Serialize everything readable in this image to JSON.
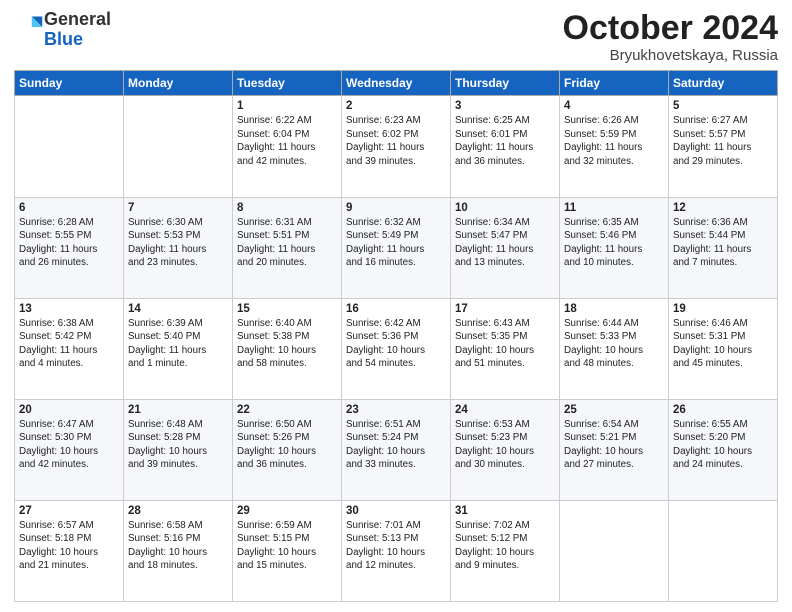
{
  "logo": {
    "general": "General",
    "blue": "Blue"
  },
  "header": {
    "month": "October 2024",
    "location": "Bryukhovetskaya, Russia"
  },
  "weekdays": [
    "Sunday",
    "Monday",
    "Tuesday",
    "Wednesday",
    "Thursday",
    "Friday",
    "Saturday"
  ],
  "weeks": [
    [
      {
        "day": "",
        "sunrise": "",
        "sunset": "",
        "daylight": ""
      },
      {
        "day": "",
        "sunrise": "",
        "sunset": "",
        "daylight": ""
      },
      {
        "day": "1",
        "sunrise": "Sunrise: 6:22 AM",
        "sunset": "Sunset: 6:04 PM",
        "daylight": "Daylight: 11 hours and 42 minutes."
      },
      {
        "day": "2",
        "sunrise": "Sunrise: 6:23 AM",
        "sunset": "Sunset: 6:02 PM",
        "daylight": "Daylight: 11 hours and 39 minutes."
      },
      {
        "day": "3",
        "sunrise": "Sunrise: 6:25 AM",
        "sunset": "Sunset: 6:01 PM",
        "daylight": "Daylight: 11 hours and 36 minutes."
      },
      {
        "day": "4",
        "sunrise": "Sunrise: 6:26 AM",
        "sunset": "Sunset: 5:59 PM",
        "daylight": "Daylight: 11 hours and 32 minutes."
      },
      {
        "day": "5",
        "sunrise": "Sunrise: 6:27 AM",
        "sunset": "Sunset: 5:57 PM",
        "daylight": "Daylight: 11 hours and 29 minutes."
      }
    ],
    [
      {
        "day": "6",
        "sunrise": "Sunrise: 6:28 AM",
        "sunset": "Sunset: 5:55 PM",
        "daylight": "Daylight: 11 hours and 26 minutes."
      },
      {
        "day": "7",
        "sunrise": "Sunrise: 6:30 AM",
        "sunset": "Sunset: 5:53 PM",
        "daylight": "Daylight: 11 hours and 23 minutes."
      },
      {
        "day": "8",
        "sunrise": "Sunrise: 6:31 AM",
        "sunset": "Sunset: 5:51 PM",
        "daylight": "Daylight: 11 hours and 20 minutes."
      },
      {
        "day": "9",
        "sunrise": "Sunrise: 6:32 AM",
        "sunset": "Sunset: 5:49 PM",
        "daylight": "Daylight: 11 hours and 16 minutes."
      },
      {
        "day": "10",
        "sunrise": "Sunrise: 6:34 AM",
        "sunset": "Sunset: 5:47 PM",
        "daylight": "Daylight: 11 hours and 13 minutes."
      },
      {
        "day": "11",
        "sunrise": "Sunrise: 6:35 AM",
        "sunset": "Sunset: 5:46 PM",
        "daylight": "Daylight: 11 hours and 10 minutes."
      },
      {
        "day": "12",
        "sunrise": "Sunrise: 6:36 AM",
        "sunset": "Sunset: 5:44 PM",
        "daylight": "Daylight: 11 hours and 7 minutes."
      }
    ],
    [
      {
        "day": "13",
        "sunrise": "Sunrise: 6:38 AM",
        "sunset": "Sunset: 5:42 PM",
        "daylight": "Daylight: 11 hours and 4 minutes."
      },
      {
        "day": "14",
        "sunrise": "Sunrise: 6:39 AM",
        "sunset": "Sunset: 5:40 PM",
        "daylight": "Daylight: 11 hours and 1 minute."
      },
      {
        "day": "15",
        "sunrise": "Sunrise: 6:40 AM",
        "sunset": "Sunset: 5:38 PM",
        "daylight": "Daylight: 10 hours and 58 minutes."
      },
      {
        "day": "16",
        "sunrise": "Sunrise: 6:42 AM",
        "sunset": "Sunset: 5:36 PM",
        "daylight": "Daylight: 10 hours and 54 minutes."
      },
      {
        "day": "17",
        "sunrise": "Sunrise: 6:43 AM",
        "sunset": "Sunset: 5:35 PM",
        "daylight": "Daylight: 10 hours and 51 minutes."
      },
      {
        "day": "18",
        "sunrise": "Sunrise: 6:44 AM",
        "sunset": "Sunset: 5:33 PM",
        "daylight": "Daylight: 10 hours and 48 minutes."
      },
      {
        "day": "19",
        "sunrise": "Sunrise: 6:46 AM",
        "sunset": "Sunset: 5:31 PM",
        "daylight": "Daylight: 10 hours and 45 minutes."
      }
    ],
    [
      {
        "day": "20",
        "sunrise": "Sunrise: 6:47 AM",
        "sunset": "Sunset: 5:30 PM",
        "daylight": "Daylight: 10 hours and 42 minutes."
      },
      {
        "day": "21",
        "sunrise": "Sunrise: 6:48 AM",
        "sunset": "Sunset: 5:28 PM",
        "daylight": "Daylight: 10 hours and 39 minutes."
      },
      {
        "day": "22",
        "sunrise": "Sunrise: 6:50 AM",
        "sunset": "Sunset: 5:26 PM",
        "daylight": "Daylight: 10 hours and 36 minutes."
      },
      {
        "day": "23",
        "sunrise": "Sunrise: 6:51 AM",
        "sunset": "Sunset: 5:24 PM",
        "daylight": "Daylight: 10 hours and 33 minutes."
      },
      {
        "day": "24",
        "sunrise": "Sunrise: 6:53 AM",
        "sunset": "Sunset: 5:23 PM",
        "daylight": "Daylight: 10 hours and 30 minutes."
      },
      {
        "day": "25",
        "sunrise": "Sunrise: 6:54 AM",
        "sunset": "Sunset: 5:21 PM",
        "daylight": "Daylight: 10 hours and 27 minutes."
      },
      {
        "day": "26",
        "sunrise": "Sunrise: 6:55 AM",
        "sunset": "Sunset: 5:20 PM",
        "daylight": "Daylight: 10 hours and 24 minutes."
      }
    ],
    [
      {
        "day": "27",
        "sunrise": "Sunrise: 6:57 AM",
        "sunset": "Sunset: 5:18 PM",
        "daylight": "Daylight: 10 hours and 21 minutes."
      },
      {
        "day": "28",
        "sunrise": "Sunrise: 6:58 AM",
        "sunset": "Sunset: 5:16 PM",
        "daylight": "Daylight: 10 hours and 18 minutes."
      },
      {
        "day": "29",
        "sunrise": "Sunrise: 6:59 AM",
        "sunset": "Sunset: 5:15 PM",
        "daylight": "Daylight: 10 hours and 15 minutes."
      },
      {
        "day": "30",
        "sunrise": "Sunrise: 7:01 AM",
        "sunset": "Sunset: 5:13 PM",
        "daylight": "Daylight: 10 hours and 12 minutes."
      },
      {
        "day": "31",
        "sunrise": "Sunrise: 7:02 AM",
        "sunset": "Sunset: 5:12 PM",
        "daylight": "Daylight: 10 hours and 9 minutes."
      },
      {
        "day": "",
        "sunrise": "",
        "sunset": "",
        "daylight": ""
      },
      {
        "day": "",
        "sunrise": "",
        "sunset": "",
        "daylight": ""
      }
    ]
  ]
}
